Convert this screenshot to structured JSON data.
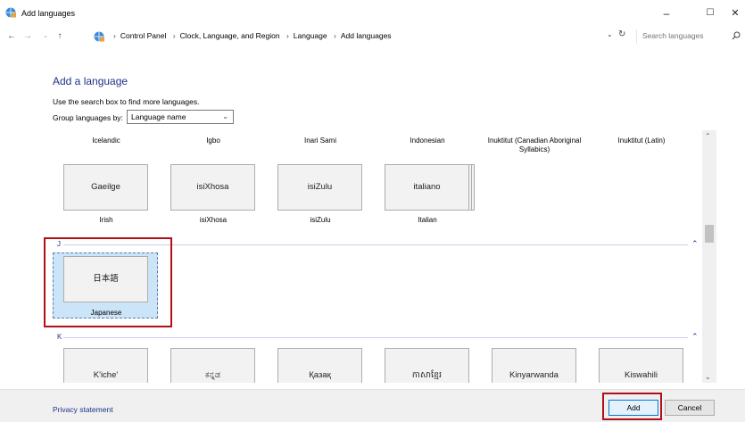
{
  "window": {
    "title": "Add languages",
    "minimize": "–",
    "maximize": "☐",
    "close": "✕"
  },
  "address": {
    "breadcrumbs": [
      "Control Panel",
      "Clock, Language, and Region",
      "Language",
      "Add languages"
    ],
    "search_placeholder": "Search languages"
  },
  "content": {
    "title": "Add a language",
    "instructions": "Use the search box to find more languages.",
    "group_by_label": "Group languages by:",
    "group_by_value": "Language name"
  },
  "languages": {
    "column_headers": [
      "Icelandic",
      "Igbo",
      "Inari Sami",
      "Indonesian",
      "Inuktitut (Canadian Aboriginal Syllabics)",
      "Inuktitut (Latin)"
    ],
    "row_i": [
      {
        "native": "Gaeilge",
        "english": "Irish"
      },
      {
        "native": "isiXhosa",
        "english": "isiXhosa"
      },
      {
        "native": "isiZulu",
        "english": "isiZulu"
      },
      {
        "native": "italiano",
        "english": "Italian"
      }
    ],
    "group_j": {
      "letter": "J",
      "items": [
        {
          "native": "日本語",
          "english": "Japanese"
        }
      ]
    },
    "group_k": {
      "letter": "K",
      "items": [
        "K'iche'",
        "ಕನ್ನಡ",
        "Қазақ",
        "កាសាខ្មែរ",
        "Kinyarwanda",
        "Kiswahili"
      ]
    }
  },
  "footer": {
    "privacy": "Privacy statement",
    "add": "Add",
    "cancel": "Cancel"
  },
  "colors": {
    "accent": "#1e3287",
    "selection": "#cce4f7",
    "highlight": "#b30f18"
  }
}
